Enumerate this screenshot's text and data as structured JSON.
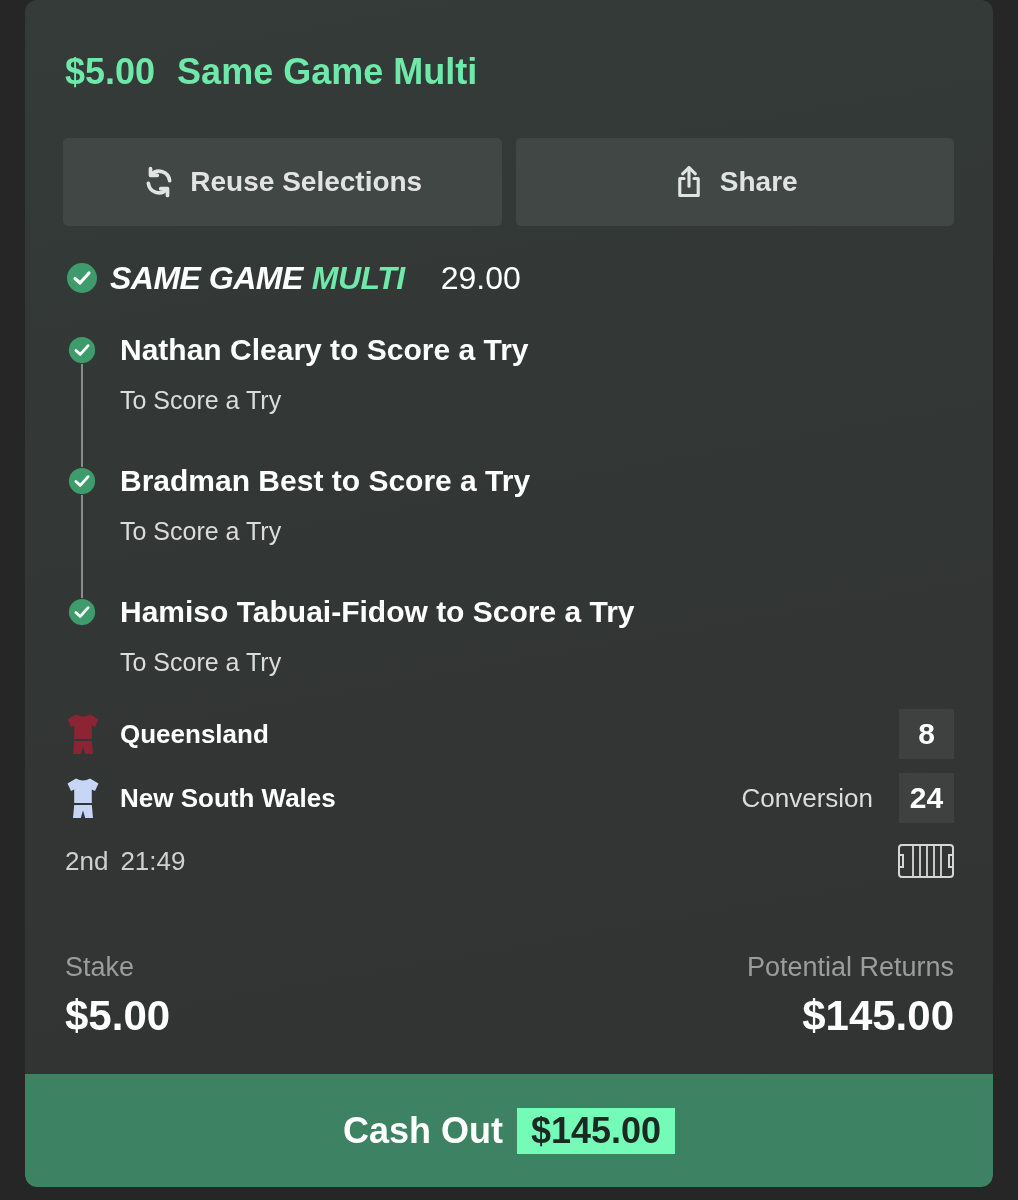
{
  "header": {
    "stake": "$5.00",
    "title": "Same Game Multi"
  },
  "actions": [
    {
      "kind": "reuse",
      "label": "Reuse Selections"
    },
    {
      "kind": "share",
      "label": "Share"
    }
  ],
  "bet": {
    "settled": true,
    "title_parts": [
      {
        "text": "SAME GAME",
        "accent": false
      },
      {
        "text": "MULTI",
        "accent": true
      }
    ],
    "odds": "29.00"
  },
  "legs": [
    {
      "selection": "Nathan Cleary to Score a Try",
      "market": "To Score a Try",
      "won": true
    },
    {
      "selection": "Bradman Best to Score a Try",
      "market": "To Score a Try",
      "won": true
    },
    {
      "selection": "Hamiso Tabuai-Fidow to Score a Try",
      "market": "To Score a Try",
      "won": true
    }
  ],
  "teams": [
    {
      "name": "Queensland",
      "color": "#8c2434",
      "score": "8"
    },
    {
      "name": "New South Wales",
      "color": "#c6d6f4",
      "event": "Conversion",
      "score": "24"
    }
  ],
  "clock": {
    "period": "2nd",
    "time": "21:49"
  },
  "summary": [
    {
      "label": "Stake",
      "value": "$5.00"
    },
    {
      "label": "Potential Returns",
      "value": "$145.00"
    }
  ],
  "cash_out": {
    "label": "Cash Out",
    "amount": "$145.00"
  }
}
